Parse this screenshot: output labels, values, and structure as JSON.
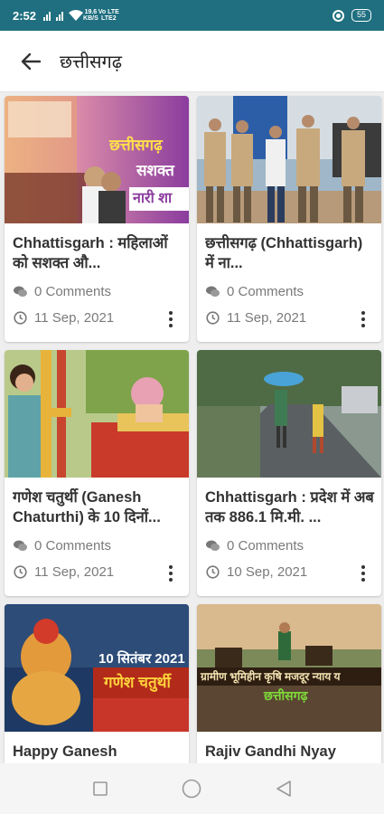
{
  "status_bar": {
    "time": "2:52",
    "net_speed_top": "19.6",
    "net_speed_bottom": "KB/S",
    "lte_top": "Vo LTE",
    "lte_bottom": "LTE2",
    "battery": "55"
  },
  "app_bar": {
    "title": "छत्तीसगढ़",
    "back_icon": "arrow-left-icon"
  },
  "articles": [
    {
      "title": "Chhattisgarh : महिलाओं को सशक्त औ...",
      "comments": "0 Comments",
      "date": "11 Sep, 2021",
      "thumb_text_1": "छत्तीसगढ़",
      "thumb_text_2": "सशक्त",
      "thumb_text_3": "नारी शा"
    },
    {
      "title": "छत्तीसगढ़ (Chhattisgarh) में ना...",
      "comments": "0 Comments",
      "date": "11 Sep, 2021"
    },
    {
      "title": "गणेश चतुर्थी (Ganesh Chaturthi) के 10 दिनों...",
      "comments": "0 Comments",
      "date": "11 Sep, 2021"
    },
    {
      "title": "Chhattisgarh : प्रदेश में अब तक 886.1 मि.मी. ...",
      "comments": "0 Comments",
      "date": "10 Sep, 2021"
    },
    {
      "title": "Happy Ganesh",
      "comments": "",
      "date": "",
      "thumb_text_1": "10 सितंबर 2021",
      "thumb_text_2": "गणेश चतुर्थी"
    },
    {
      "title": "Rajiv Gandhi Nyay",
      "comments": "",
      "date": "",
      "thumb_text_1": "ग्रामीण भूमिहीन कृषि मजदूर न्याय य",
      "thumb_text_2": "छत्तीसगढ़"
    }
  ],
  "icons": {
    "comment": "comment-icon",
    "clock": "clock-icon",
    "more": "more-vertical-icon"
  },
  "colors": {
    "status_bar": "#1f6f80",
    "title_text": "#333333",
    "meta_text": "#7a7a7a"
  }
}
